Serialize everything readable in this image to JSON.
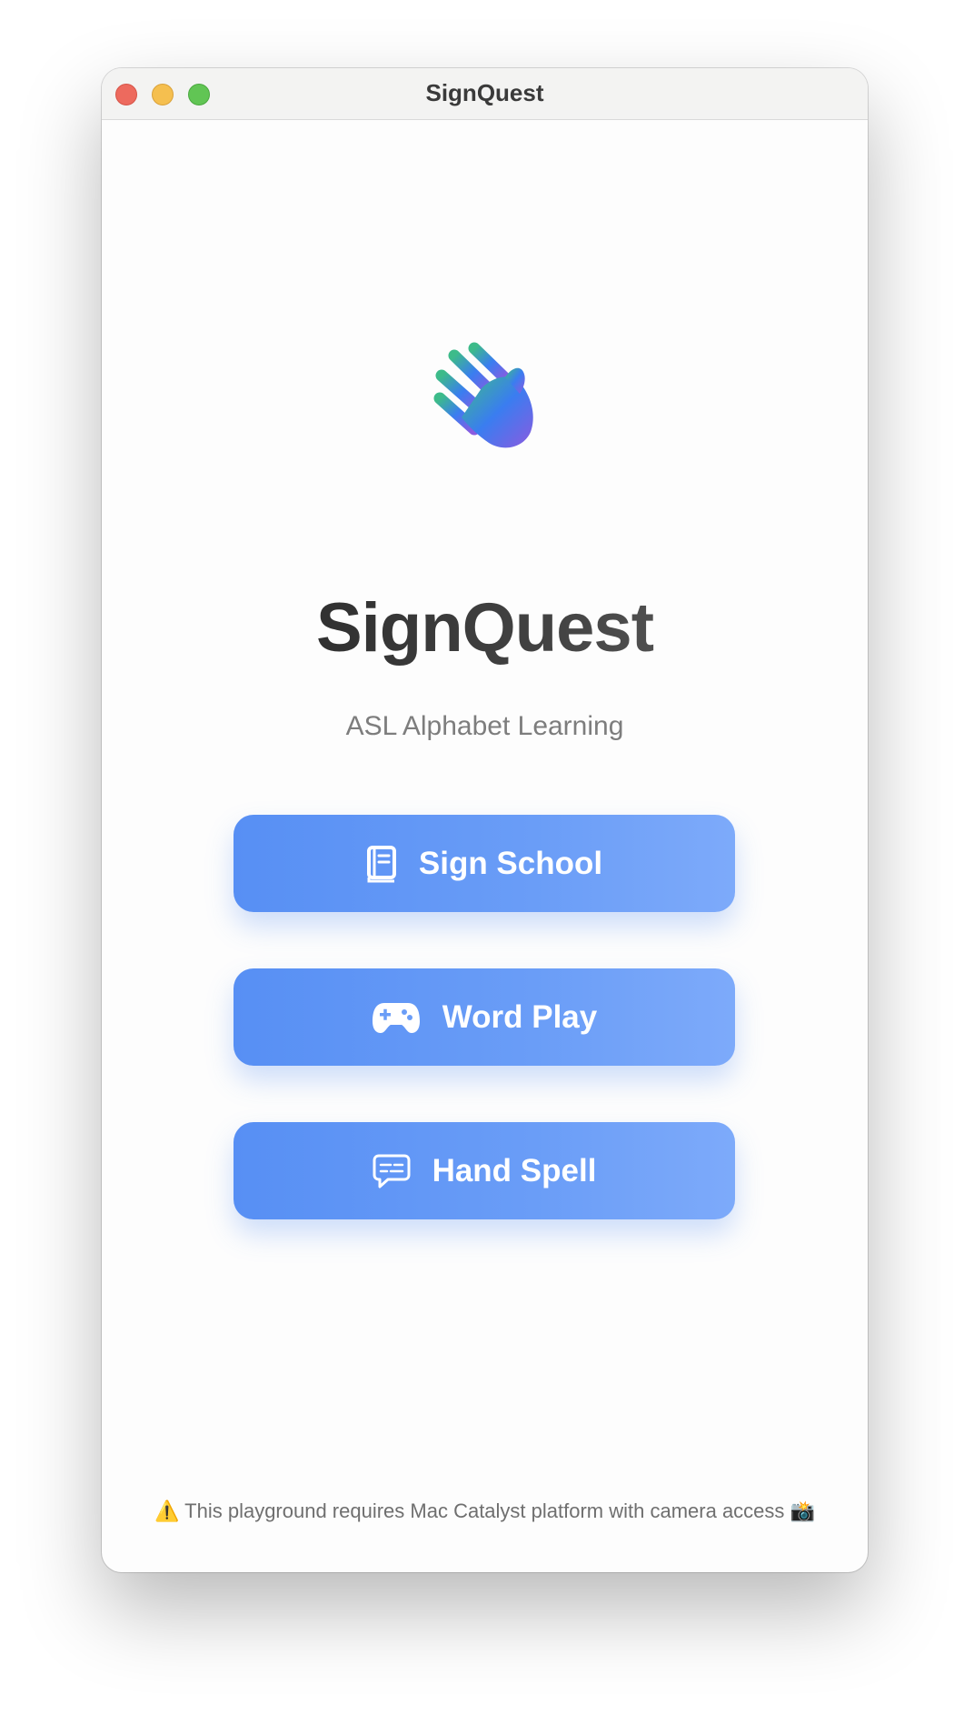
{
  "window": {
    "title": "SignQuest"
  },
  "main": {
    "logo_icon": "waving-hand-icon",
    "app_title": "SignQuest",
    "subtitle": "ASL Alphabet Learning",
    "buttons": [
      {
        "label": "Sign School",
        "icon": "book-icon"
      },
      {
        "label": "Word Play",
        "icon": "gamepad-icon"
      },
      {
        "label": "Hand Spell",
        "icon": "speech-bubble-icon"
      }
    ]
  },
  "footer": {
    "warning_emoji": "⚠️",
    "text": "This playground requires Mac Catalyst platform with camera access",
    "camera_emoji": "📸"
  },
  "colors": {
    "accent": "#5b93f5",
    "title_text": "#2b2b2b",
    "subtitle_text": "#7d7d7d"
  }
}
